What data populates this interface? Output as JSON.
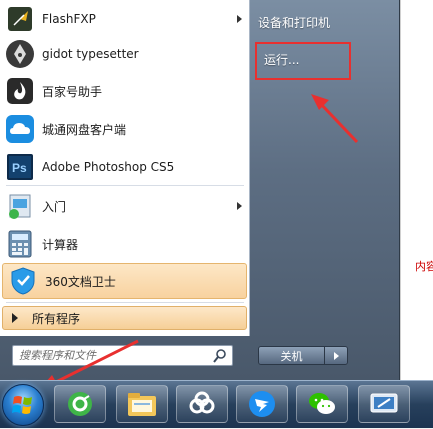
{
  "start_menu": {
    "programs": [
      {
        "label": "FlashFXP",
        "icon": "flashfxp-icon",
        "has_submenu": true
      },
      {
        "label": "gidot typesetter",
        "icon": "pen-nib-icon",
        "has_submenu": false
      },
      {
        "label": "百家号助手",
        "icon": "baijiahao-icon",
        "has_submenu": false
      },
      {
        "label": "城通网盘客户端",
        "icon": "cloud-drive-icon",
        "has_submenu": false
      },
      {
        "label": "Adobe Photoshop CS5",
        "icon": "photoshop-icon",
        "has_submenu": false
      },
      {
        "label": "入门",
        "icon": "getting-started-icon",
        "has_submenu": true
      },
      {
        "label": "计算器",
        "icon": "calculator-icon",
        "has_submenu": false
      },
      {
        "label": "360文档卫士",
        "icon": "360-shield-icon",
        "has_submenu": false,
        "highlighted": true
      }
    ],
    "all_programs_label": "所有程序",
    "search_placeholder": "搜索程序和文件",
    "right_items": {
      "devices_printers": "设备和打印机",
      "run": "运行..."
    },
    "shutdown_label": "关机"
  },
  "page_side_text": "内容",
  "taskbar": {
    "apps": [
      "browser-360-icon",
      "file-explorer-icon",
      "baidu-netdisk-icon",
      "dingtalk-icon",
      "wechat-icon",
      "remote-desktop-icon"
    ]
  },
  "colors": {
    "highlight": "#f8d29f",
    "annotation_red": "#e8302f",
    "taskbar": "#27405c"
  }
}
